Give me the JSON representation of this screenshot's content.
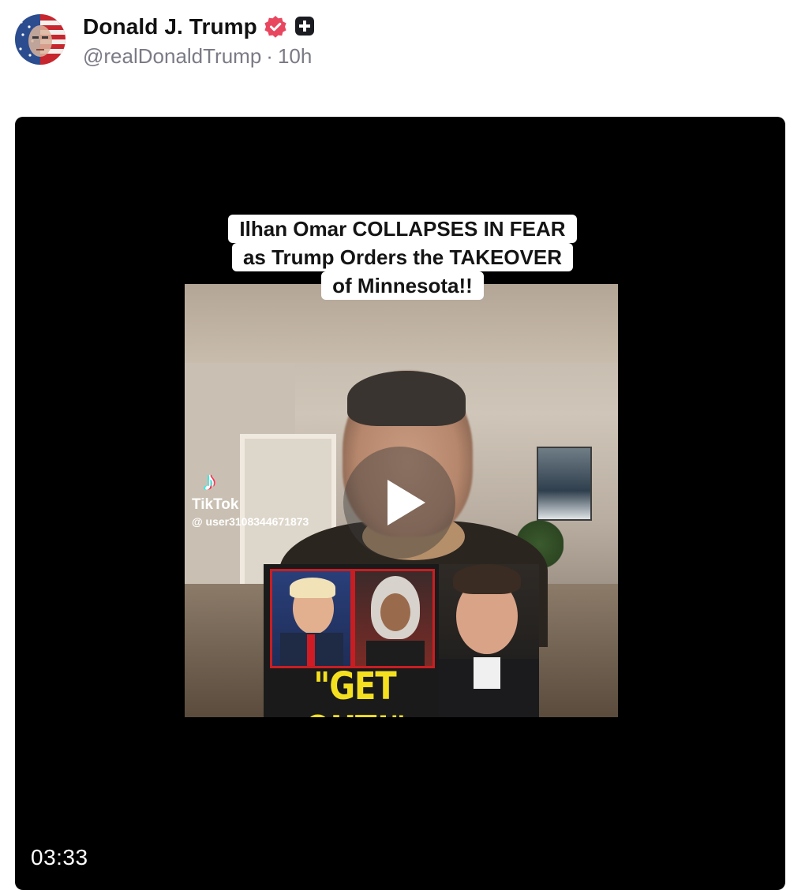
{
  "post": {
    "display_name": "Donald J. Trump",
    "handle": "@realDonaldTrump",
    "separator": "·",
    "time_ago": "10h",
    "verified_icon": "verified-badge-icon",
    "extra_icon": "plus-box-icon",
    "brand_color": "#e8475f"
  },
  "video": {
    "caption_lines": [
      "Ilhan Omar COLLAPSES IN FEAR",
      "as Trump Orders the TAKEOVER",
      "of Minnesota!!"
    ],
    "tiktok_brand": "TikTok",
    "tiktok_handle": "@ user3108344671873",
    "thumbnail_text": "\"GET OUT!\"",
    "duration": "03:33",
    "play_icon": "play-icon"
  }
}
